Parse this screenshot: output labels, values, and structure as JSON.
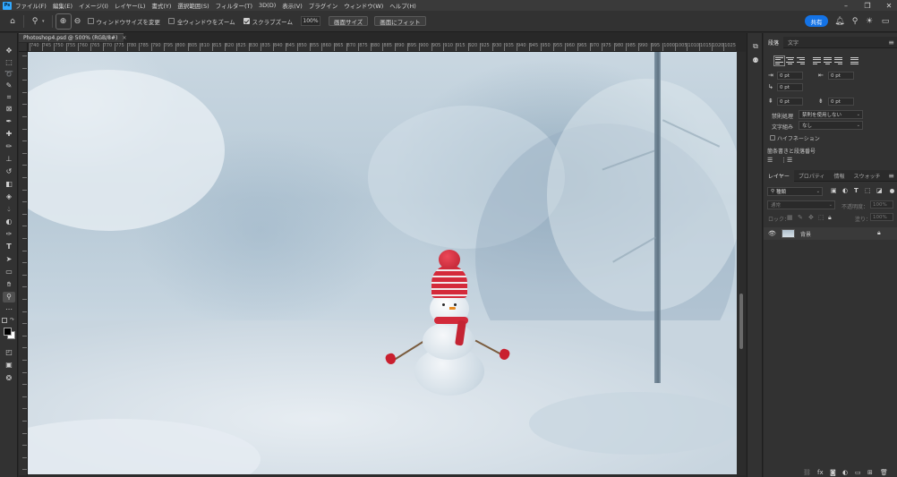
{
  "app": {
    "logo_text": "Ps",
    "menu": [
      "ファイル(F)",
      "編集(E)",
      "イメージ(I)",
      "レイヤー(L)",
      "書式(Y)",
      "選択範囲(S)",
      "フィルター(T)",
      "3D(D)",
      "表示(V)",
      "プラグイン",
      "ウィンドウ(W)",
      "ヘルプ(H)"
    ],
    "window_controls": {
      "minimize": "–",
      "restore": "❐",
      "close": "✕"
    }
  },
  "options_bar": {
    "checkbox_resize_windows": {
      "label": "ウィンドウサイズを変更",
      "checked": false
    },
    "checkbox_zoom_all": {
      "label": "全ウィンドウをズーム",
      "checked": false
    },
    "checkbox_scrubby_zoom": {
      "label": "スクラブズーム",
      "checked": true
    },
    "zoom_value": "100%",
    "fit_screen_label": "画面サイズ",
    "fill_screen_label": "画面にフィット",
    "share_label": "共有"
  },
  "document": {
    "tab_title": "Photoshop4.psd @ 500% (RGB/8#)",
    "tab_close": "×",
    "ruler_labels": [
      "740",
      "745",
      "750",
      "755",
      "760",
      "765",
      "770",
      "775",
      "780",
      "785",
      "790",
      "795",
      "800",
      "805",
      "810",
      "815",
      "820",
      "825",
      "830",
      "835",
      "840",
      "845",
      "850",
      "855",
      "860",
      "865",
      "870",
      "875",
      "880",
      "885",
      "890",
      "895",
      "900",
      "905",
      "910",
      "915",
      "920",
      "925",
      "930",
      "935",
      "940",
      "945",
      "950",
      "955",
      "960",
      "965",
      "970",
      "975",
      "980",
      "985",
      "990",
      "995",
      "1000",
      "1005",
      "1010",
      "1015",
      "1020",
      "1025"
    ]
  },
  "paragraph_panel": {
    "tabs": [
      "段落",
      "文字"
    ],
    "active_tab": 0,
    "indent_left": "0 pt",
    "indent_right": "0 pt",
    "indent_first": "0 pt",
    "space_before": "0 pt",
    "space_after": "0 pt",
    "kinsoku_label": "禁則処理",
    "kinsoku_value": "禁則を使用しない",
    "mojikumi_label": "文字組み",
    "mojikumi_value": "なし",
    "hyphenation_label": "ハイフネーション",
    "hyphenation_checked": false,
    "footer_text": "箇条書きと段落番号"
  },
  "layers_panel": {
    "tabs": [
      "レイヤー",
      "プロパティ",
      "情報",
      "スウォッチ"
    ],
    "active_tab": 0,
    "filter_label": "種類",
    "blend_mode": "通常",
    "opacity_label": "不透明度：",
    "opacity_value": "100%",
    "lock_label": "ロック：",
    "fill_label": "塗り：",
    "fill_value": "100%",
    "layers": [
      {
        "name": "背景",
        "visible": true,
        "locked": true
      }
    ]
  },
  "colors": {
    "accent": "#1473e6",
    "ps_logo": "#31a8ff",
    "panel_bg": "#323232",
    "menu_bg": "#3a3a3a"
  }
}
